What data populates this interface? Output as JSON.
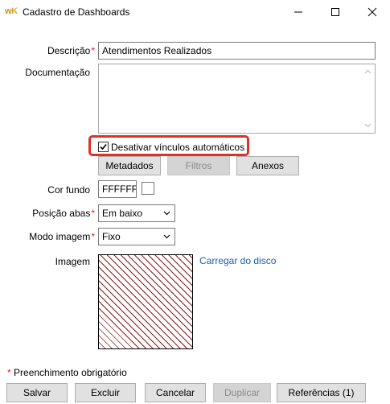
{
  "window": {
    "logo_w": "w",
    "logo_k": "K",
    "title": "Cadastro de Dashboards"
  },
  "form": {
    "descricao": {
      "label": "Descrição",
      "value": "Atendimentos Realizados",
      "required_mark": "*"
    },
    "documentacao": {
      "label": "Documentação",
      "value": ""
    },
    "desativar_vinculos": {
      "label": "Desativar vínculos automáticos",
      "checked": true
    },
    "tabs": {
      "metadados": "Metadados",
      "filtros": "Filtros",
      "anexos": "Anexos"
    },
    "cor_fundo": {
      "label": "Cor fundo",
      "value": "FFFFFF",
      "swatch_color": "#FFFFFF"
    },
    "posicao_abas": {
      "label": "Posição abas",
      "value": "Em baixo",
      "required_mark": "*"
    },
    "modo_imagem": {
      "label": "Modo imagem",
      "value": "Fixo",
      "required_mark": "*"
    },
    "imagem": {
      "label": "Imagem",
      "load_link": "Carregar do disco"
    }
  },
  "footnote": {
    "mark": "*",
    "text": "Preenchimento obrigatório"
  },
  "actions": {
    "salvar": "Salvar",
    "excluir": "Excluir",
    "cancelar": "Cancelar",
    "duplicar": "Duplicar",
    "referencias": "Referências (1)"
  },
  "colors": {
    "highlight": "#e0302a",
    "required": "#e02020",
    "link": "#1a5fb4",
    "hatch": "#8b1a1a"
  }
}
